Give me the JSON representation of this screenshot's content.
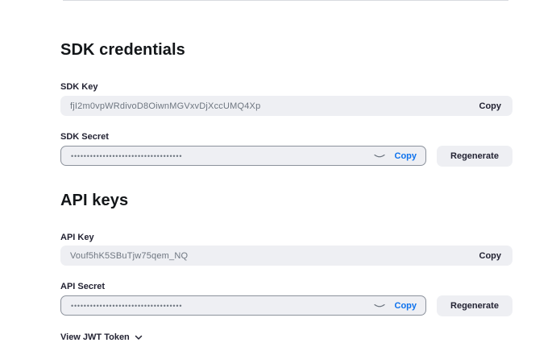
{
  "sdk": {
    "title": "SDK credentials",
    "key_label": "SDK Key",
    "key_value": "fjI2m0vpWRdivoD8OiwnMGVxvDjXccUMQ4Xp",
    "key_copy": "Copy",
    "secret_label": "SDK Secret",
    "secret_mask": "•••••••••••••••••••••••••••••••••••",
    "secret_copy": "Copy",
    "regenerate": "Regenerate"
  },
  "api": {
    "title": "API keys",
    "key_label": "API Key",
    "key_value": "Vouf5hK5SBuTjw75qem_NQ",
    "key_copy": "Copy",
    "secret_label": "API Secret",
    "secret_mask": "•••••••••••••••••••••••••••••••••••",
    "secret_copy": "Copy",
    "regenerate": "Regenerate"
  },
  "jwt": {
    "label": "View JWT Token"
  },
  "icons": {
    "visibility": "eye-closed-icon",
    "expand": "chevron-down-icon"
  },
  "colors": {
    "link_blue": "#0e72ed",
    "field_bg": "#eeeff3",
    "text_dark": "#232333"
  }
}
